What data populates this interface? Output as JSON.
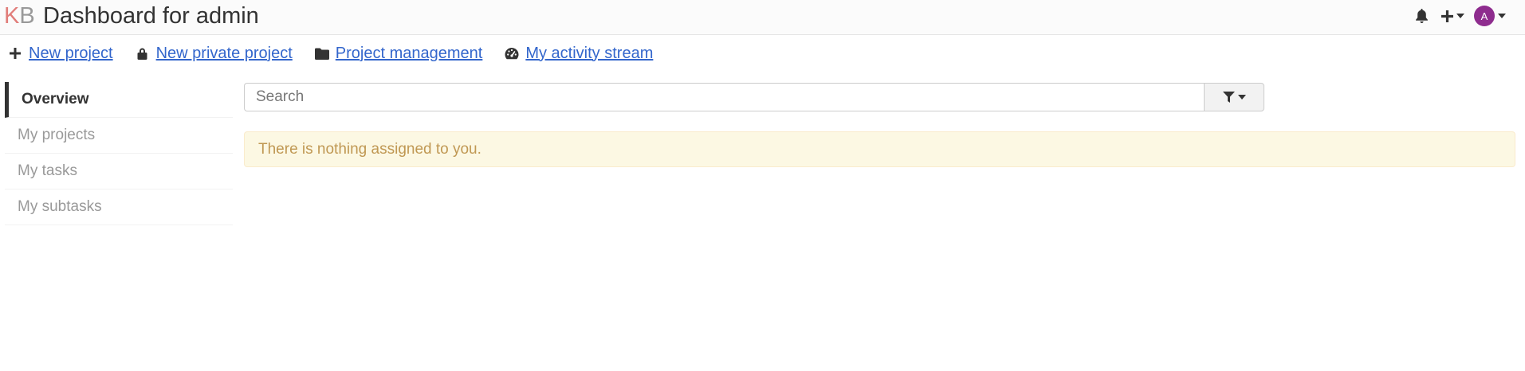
{
  "header": {
    "logo_k": "K",
    "logo_b": "B",
    "title": "Dashboard for admin",
    "avatar_letter": "A",
    "avatar_color": "#8e2c8e",
    "icons": [
      "bell-icon",
      "plus-icon",
      "chevron-down-icon"
    ]
  },
  "actions": [
    {
      "label": "New project",
      "icon": "plus-icon"
    },
    {
      "label": "New private project",
      "icon": "lock-icon"
    },
    {
      "label": "Project management",
      "icon": "folder-icon"
    },
    {
      "label": "My activity stream",
      "icon": "dashboard-icon"
    }
  ],
  "sidebar": {
    "items": [
      {
        "label": "Overview",
        "active": true
      },
      {
        "label": "My projects",
        "active": false
      },
      {
        "label": "My tasks",
        "active": false
      },
      {
        "label": "My subtasks",
        "active": false
      }
    ]
  },
  "search": {
    "placeholder": "Search",
    "value": ""
  },
  "alert": {
    "message": "There is nothing assigned to you."
  },
  "colors": {
    "link": "#3366cc",
    "alert_bg": "#fcf8e3",
    "alert_text": "#c09853",
    "logo_k": "#d9534f"
  }
}
